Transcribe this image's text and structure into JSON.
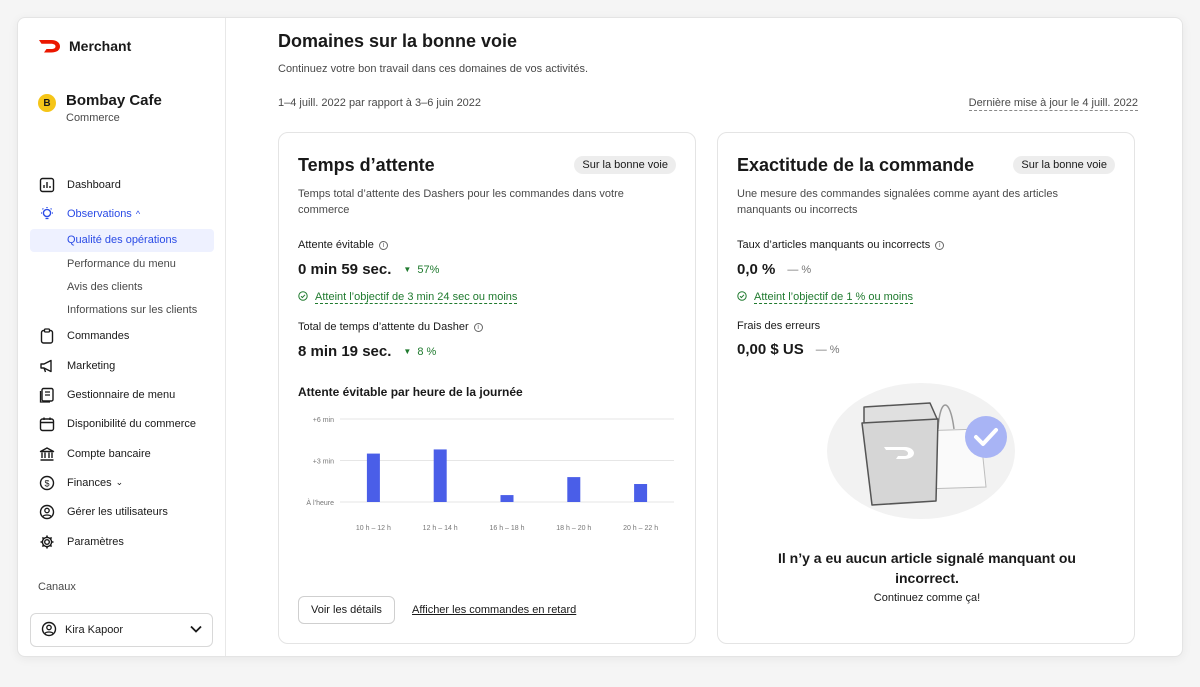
{
  "brand": {
    "name": "Merchant",
    "accent": "#eb1700"
  },
  "store": {
    "initial": "B",
    "name": "Bombay Cafe",
    "type": "Commerce"
  },
  "nav": {
    "dashboard": "Dashboard",
    "observations": "Observations",
    "observations_chevron": "^",
    "sub": [
      "Qualité des opérations",
      "Performance du menu",
      "Avis des clients",
      "Informations sur les clients"
    ],
    "commandes": "Commandes",
    "marketing": "Marketing",
    "menu": "Gestionnaire de menu",
    "disponibilite": "Disponibilité du commerce",
    "compte": "Compte bancaire",
    "finances": "Finances",
    "finances_chevron": "⌄",
    "utilisateurs": "Gérer les utilisateurs",
    "parametres": "Paramètres",
    "canaux": "Canaux"
  },
  "user": {
    "name": "Kira Kapoor"
  },
  "page": {
    "title": "Domaines sur la bonne voie",
    "subtitle": "Continuez votre bon travail dans ces domaines de vos activités.",
    "range": "1–4 juill. 2022 par rapport à 3–6 juin 2022",
    "updated": "Dernière mise à jour le 4 juill. 2022"
  },
  "wait_card": {
    "title": "Temps d’attente",
    "status": "Sur la bonne voie",
    "description": "Temps total d’attente des Dashers pour les commandes dans votre commerce",
    "avoidable_label": "Attente évitable",
    "avoidable_value": "0 min 59 sec.",
    "avoidable_delta": "57%",
    "goal": "Atteint l’objectif de 3 min 24 sec ou moins",
    "total_label": "Total de temps d’attente du Dasher",
    "total_value": "8 min 19 sec.",
    "total_delta": "8 %",
    "chart_title": "Attente évitable par heure de la journée",
    "details_button": "Voir les détails",
    "late_link": "Afficher les commandes en retard"
  },
  "accuracy_card": {
    "title": "Exactitude de la commande",
    "status": "Sur la bonne voie",
    "description": "Une mesure des commandes signalées comme ayant des articles manquants ou incorrects",
    "rate_label": "Taux d’articles manquants ou incorrects",
    "rate_value": "0,0 %",
    "rate_delta": "— %",
    "goal": "Atteint l’objectif de 1 % ou moins",
    "fees_label": "Frais des erreurs",
    "fees_value": "0,00 $ US",
    "fees_delta": "— %",
    "empty_title": "Il n’y a eu aucun article signalé manquant ou incorrect.",
    "empty_sub": "Continuez comme ça!"
  },
  "chart_data": {
    "type": "bar",
    "categories": [
      "10 h – 12 h",
      "12 h – 14 h",
      "16 h – 18 h",
      "18 h – 20 h",
      "20 h – 22 h"
    ],
    "values": [
      3.5,
      3.8,
      0.5,
      1.8,
      1.3
    ],
    "y_ticks": [
      "À l’heure",
      "+3 min",
      "+6 min"
    ],
    "ylim": [
      0,
      6
    ],
    "color": "#4a5ee8",
    "grid": true
  }
}
